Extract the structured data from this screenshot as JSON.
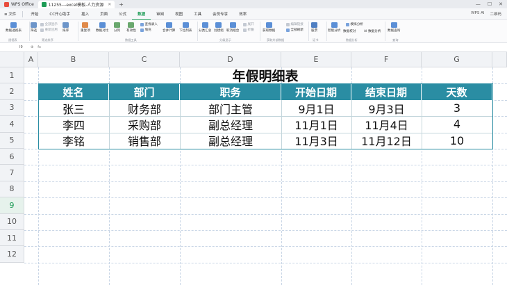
{
  "titlebar": {
    "app_name": "WPS Office",
    "doc_tab": "11255---excel模板-人力资源",
    "new_tab": "+"
  },
  "menubar": {
    "file": "≡ 文件",
    "items": [
      "开始",
      "CC开心助手",
      "插入",
      "页面",
      "公式",
      "数据",
      "审阅",
      "视图",
      "工具",
      "会员专享",
      "效率"
    ],
    "active_index": 5,
    "right": [
      "WPS AI",
      "二维码"
    ]
  },
  "ribbon": {
    "groups": [
      {
        "label": "透视表",
        "buttons": [
          "数据透视表"
        ]
      },
      {
        "label": "筛选排序",
        "buttons": [
          "筛选",
          "排序"
        ],
        "small": [
          "全部显示",
          "重新应用"
        ]
      },
      {
        "label": "数据工具",
        "buttons": [
          "重复项",
          "数据对比",
          "分列",
          "有效性",
          "下拉列表",
          "合并计算",
          "填充"
        ],
        "small": [
          "查找录入"
        ]
      },
      {
        "label": "分级显示",
        "buttons": [
          "分类汇总",
          "创建组",
          "取消组合"
        ],
        "small": [
          "展开",
          "折叠"
        ]
      },
      {
        "label": "获取外部数据",
        "buttons": [
          "获取数据",
          "全部刷新"
        ],
        "small": [
          "编辑链接"
        ]
      },
      {
        "label": "数据分析",
        "buttons": [
          "智能分析",
          "模拟分析",
          "数据校对",
          "AI 数据分析"
        ]
      },
      {
        "label": "证书",
        "buttons": [
          "股票"
        ]
      },
      {
        "label": "查询",
        "buttons": [
          "数据查询"
        ]
      }
    ]
  },
  "formulabar": {
    "cell_ref": "I9",
    "fx": "fx"
  },
  "columns": [
    "A",
    "B",
    "C",
    "D",
    "E",
    "F",
    "G"
  ],
  "rows": [
    "1",
    "2",
    "3",
    "4",
    "5",
    "6",
    "7",
    "8",
    "9",
    "10",
    "11",
    "12"
  ],
  "selected_row": "9",
  "sheet": {
    "title": "年假明细表",
    "headers": [
      "姓名",
      "部门",
      "职务",
      "开始日期",
      "结束日期",
      "天数"
    ],
    "data": [
      [
        "张三",
        "财务部",
        "部门主管",
        "9月1日",
        "9月3日",
        "3"
      ],
      [
        "李四",
        "采购部",
        "副总经理",
        "11月1日",
        "11月4日",
        "4"
      ],
      [
        "李铭",
        "销售部",
        "副总经理",
        "11月3日",
        "11月12日",
        "10"
      ]
    ]
  },
  "colors": {
    "header_fill": "#2a8da3",
    "accent": "#1c9b55"
  }
}
